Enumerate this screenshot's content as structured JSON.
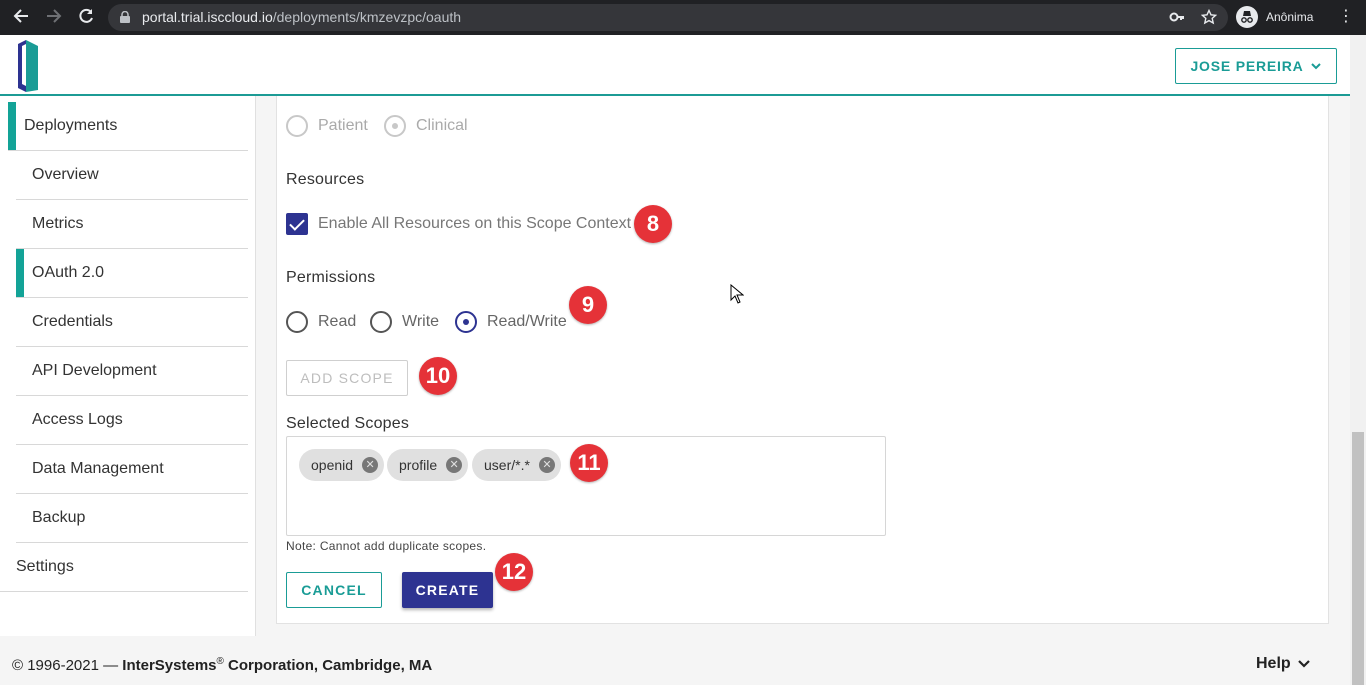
{
  "browser": {
    "url_host": "portal.trial.isccloud.io",
    "url_path": "/deployments/kmzevzpc/oauth",
    "profile_label": "Anônima",
    "icons": [
      "back-arrow-icon",
      "forward-arrow-icon",
      "reload-icon",
      "lock-icon",
      "key-icon",
      "star-icon",
      "incognito-icon",
      "more-vert-icon"
    ]
  },
  "header": {
    "user_name": "JOSE PEREIRA",
    "accent_color": "#1a9c96"
  },
  "sidebar": {
    "items": [
      {
        "label": "Deployments",
        "level": "top",
        "active": true
      },
      {
        "label": "Overview",
        "level": "sub",
        "active": false
      },
      {
        "label": "Metrics",
        "level": "sub",
        "active": false
      },
      {
        "label": "OAuth 2.0",
        "level": "sub",
        "active": true
      },
      {
        "label": "Credentials",
        "level": "sub",
        "active": false
      },
      {
        "label": "API Development",
        "level": "sub",
        "active": false
      },
      {
        "label": "Access Logs",
        "level": "sub",
        "active": false
      },
      {
        "label": "Data Management",
        "level": "sub",
        "active": false
      },
      {
        "label": "Backup",
        "level": "sub",
        "active": false
      },
      {
        "label": "Settings",
        "level": "top",
        "active": false
      }
    ]
  },
  "form": {
    "context": {
      "options": [
        {
          "label": "Patient",
          "checked": false
        },
        {
          "label": "Clinical",
          "checked": true
        }
      ]
    },
    "resources": {
      "title": "Resources",
      "checkbox_label": "Enable All Resources on this Scope Context",
      "checked": true
    },
    "permissions": {
      "title": "Permissions",
      "options": [
        {
          "label": "Read",
          "checked": false
        },
        {
          "label": "Write",
          "checked": false
        },
        {
          "label": "Read/Write",
          "checked": true
        }
      ]
    },
    "add_scope_label": "ADD SCOPE",
    "selected_scopes": {
      "title": "Selected Scopes",
      "chips": [
        "openid",
        "profile",
        "user/*.*"
      ]
    },
    "note": "Note: Cannot add duplicate scopes.",
    "cancel_label": "CANCEL",
    "create_label": "CREATE",
    "primary_color": "#2d3391"
  },
  "annotations": [
    "8",
    "9",
    "10",
    "11",
    "12"
  ],
  "footer": {
    "copyright_prefix": "© 1996-2021 — ",
    "company": "InterSystems",
    "registered": "®",
    "company_suffix": " Corporation, Cambridge, MA",
    "help_label": "Help"
  }
}
